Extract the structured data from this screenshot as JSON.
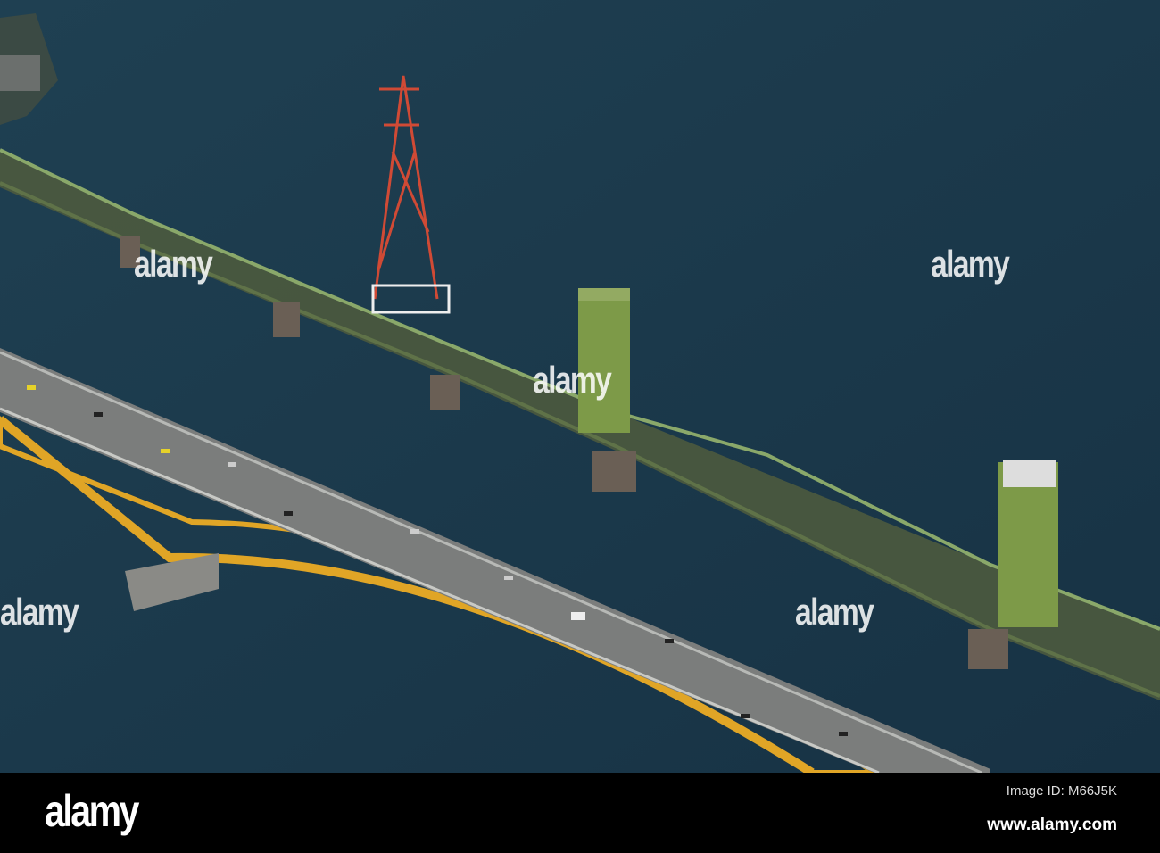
{
  "photo": {
    "subject": "aerial-bridges",
    "colors": {
      "water": "#1c3a4c",
      "arch": "#e0a526",
      "deck": "#7b7d7c",
      "truss": "#6f8a4a",
      "tower": "#c8553c"
    }
  },
  "watermark": {
    "text": "alamy"
  },
  "footer": {
    "logo": "alamy",
    "image_id": "Image ID: M66J5K",
    "url": "www.alamy.com"
  }
}
